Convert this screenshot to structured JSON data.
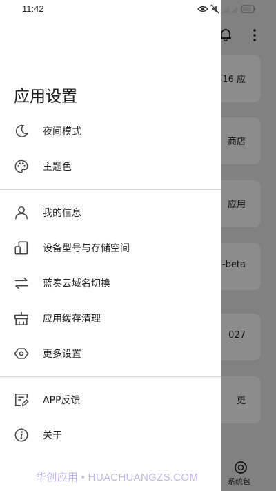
{
  "status_bar": {
    "time": "11:42"
  },
  "background_app": {
    "cards": [
      "516 应",
      "商店",
      "应用",
      "-beta",
      "027",
      "更"
    ],
    "bottom_nav_label": "系统包"
  },
  "drawer": {
    "title": "应用设置",
    "group1": [
      {
        "label": "夜间模式",
        "icon": "moon-icon"
      },
      {
        "label": "主题色",
        "icon": "palette-icon"
      }
    ],
    "group2": [
      {
        "label": "我的信息",
        "icon": "person-icon"
      },
      {
        "label": "设备型号与存储空间",
        "icon": "device-storage-icon"
      },
      {
        "label": "蓝奏云域名切换",
        "icon": "swap-arrows-icon"
      },
      {
        "label": "应用缓存清理",
        "icon": "broom-icon"
      },
      {
        "label": "更多设置",
        "icon": "hexagon-settings-icon"
      }
    ],
    "group3": [
      {
        "label": "APP反馈",
        "icon": "feedback-icon"
      },
      {
        "label": "关于",
        "icon": "info-icon"
      }
    ]
  },
  "watermark": "华创应用 • HUACHUANGZS.COM"
}
